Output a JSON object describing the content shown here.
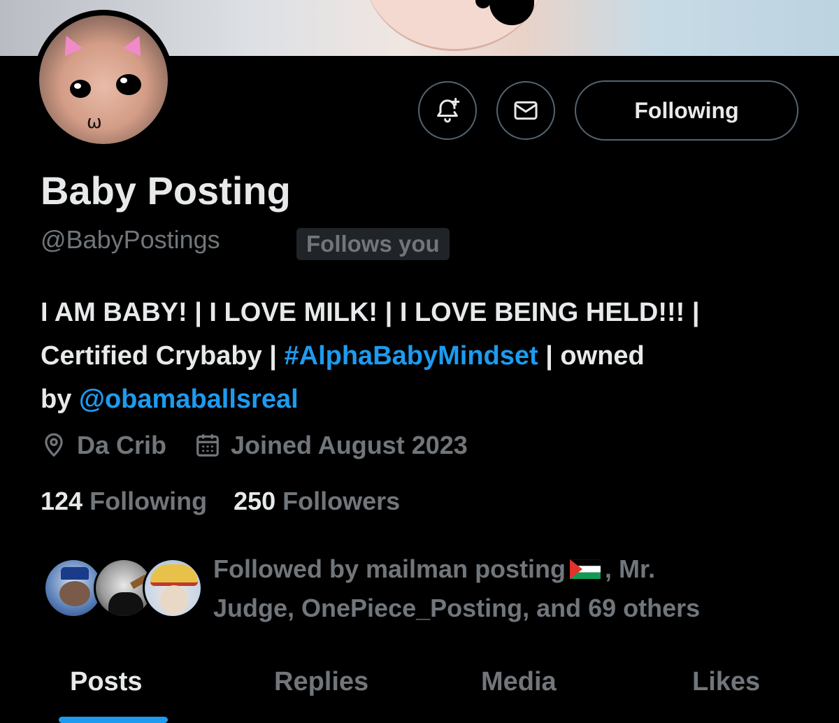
{
  "profile": {
    "name": "Baby Posting",
    "handle": "@BabyPostings",
    "follows_you": "Follows you"
  },
  "actions": {
    "follow_label": "Following",
    "notify_icon": "bell-plus-icon",
    "message_icon": "envelope-icon"
  },
  "bio": {
    "line1": "I AM BABY! | I LOVE MILK! | I LOVE BEING HELD!!! |",
    "line2_pre": "Certified Crybaby | ",
    "hashtag": "#AlphaBabyMindset",
    "line2_post": " | owned",
    "line3_pre": "by ",
    "mention": "@obamaballsreal"
  },
  "meta": {
    "location": "Da Crib",
    "joined": "Joined August 2023"
  },
  "counts": {
    "following_num": "124",
    "following_label": "Following",
    "followers_num": "250",
    "followers_label": "Followers"
  },
  "followed_by": {
    "part1": "Followed by mailman posting",
    "part2": ", Mr.",
    "part3": "Judge, OnePiece_Posting, and 69 others"
  },
  "tabs": [
    {
      "label": "Posts",
      "active": true
    },
    {
      "label": "Replies",
      "active": false
    },
    {
      "label": "Media",
      "active": false
    },
    {
      "label": "Likes",
      "active": false
    }
  ],
  "colors": {
    "accent": "#1d9bf0",
    "background": "#000000",
    "text": "#e7e9ea",
    "muted": "#71767b"
  }
}
